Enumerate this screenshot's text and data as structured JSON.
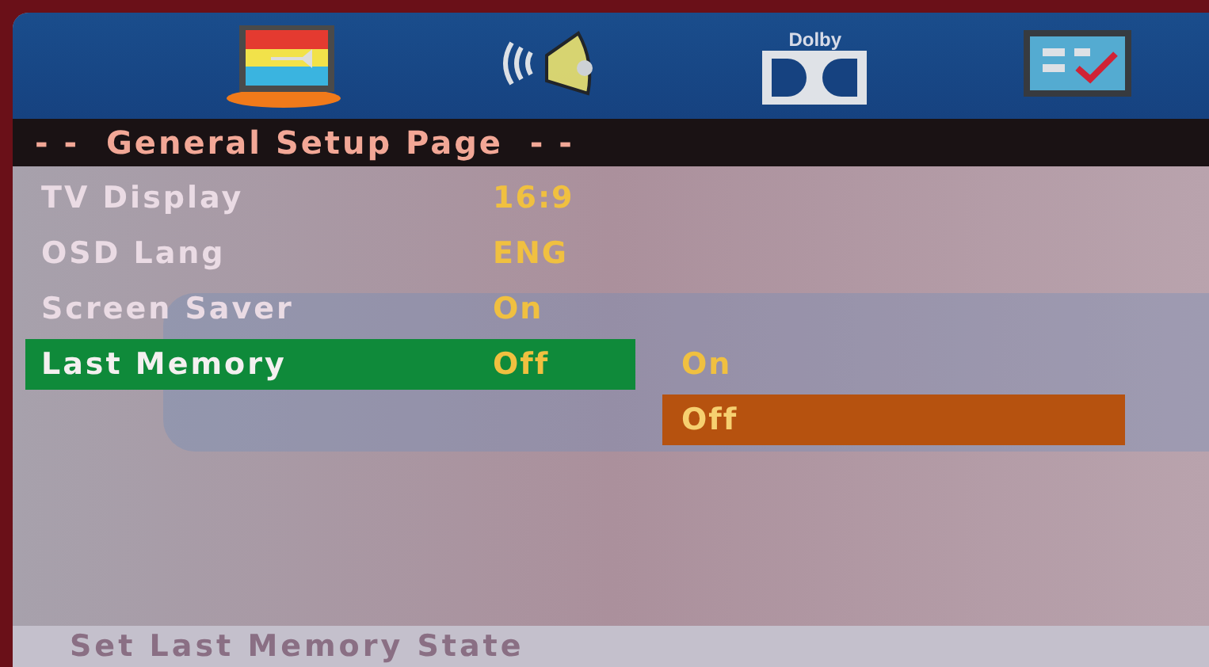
{
  "tabs": [
    {
      "kind": "tv",
      "selected": true
    },
    {
      "kind": "speaker",
      "selected": false
    },
    {
      "kind": "dolby",
      "label": "Dolby",
      "selected": false
    },
    {
      "kind": "checklist",
      "selected": false
    }
  ],
  "page_title": "- -  General Setup Page  - -",
  "settings": [
    {
      "label": "TV Display",
      "value": "16:9",
      "selected": false
    },
    {
      "label": "OSD Lang",
      "value": "ENG",
      "selected": false
    },
    {
      "label": "Screen Saver",
      "value": "On",
      "selected": false
    },
    {
      "label": "Last Memory",
      "value": "Off",
      "selected": true
    }
  ],
  "options": [
    {
      "label": "On",
      "selected": false
    },
    {
      "label": "Off",
      "selected": true
    }
  ],
  "status_bar": "Set Last Memory State"
}
